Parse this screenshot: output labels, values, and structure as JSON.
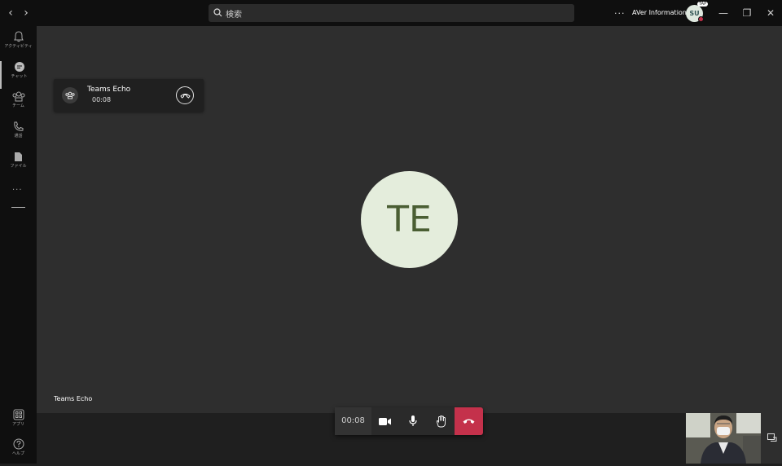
{
  "titlebar": {
    "back": "‹",
    "forward": "›",
    "search_placeholder": "検索",
    "more": "···",
    "org_name": "AVer Information",
    "avatar_initials": "SU",
    "avatar_badge": "TAP",
    "minimize": "—",
    "restore": "❐",
    "close": "✕"
  },
  "sidebar": {
    "items": [
      {
        "label": "アクティビティ",
        "icon": "bell-icon"
      },
      {
        "label": "チャット",
        "icon": "chat-icon"
      },
      {
        "label": "チーム",
        "icon": "teams-icon"
      },
      {
        "label": "通話",
        "icon": "phone-icon"
      },
      {
        "label": "ファイル",
        "icon": "file-icon"
      }
    ],
    "more": "···",
    "bottom_items": [
      {
        "label": "アプリ",
        "icon": "apps-icon"
      },
      {
        "label": "ヘルプ",
        "icon": "help-icon"
      }
    ]
  },
  "call_card": {
    "title": "Teams Echo",
    "elapsed": "00:08"
  },
  "stage": {
    "avatar_initials": "TE",
    "participant_name": "Teams Echo"
  },
  "controls": {
    "elapsed": "00:08"
  },
  "colors": {
    "end_call": "#c4314b",
    "avatar_bg": "#e4eddc",
    "avatar_text": "#4a5e33"
  }
}
